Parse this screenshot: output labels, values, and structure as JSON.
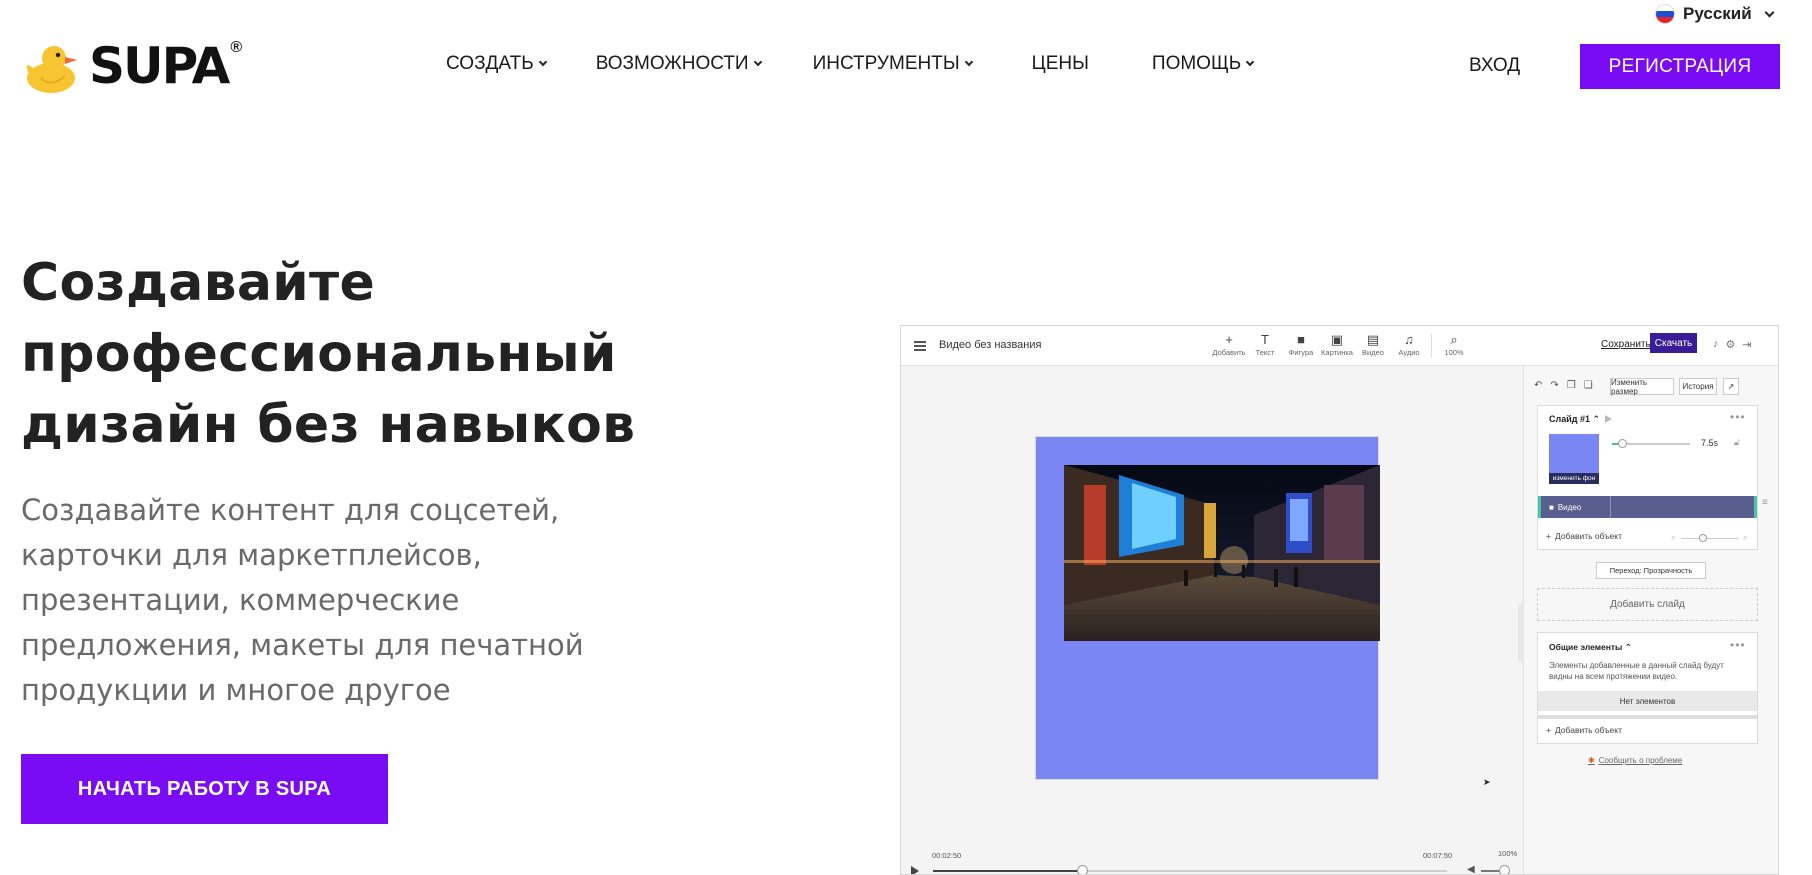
{
  "header": {
    "language": "Русский",
    "logo_text": "SUPA",
    "logo_reg": "®",
    "nav": [
      {
        "label": "СОЗДАТЬ",
        "dropdown": true
      },
      {
        "label": "ВОЗМОЖНОСТИ",
        "dropdown": true
      },
      {
        "label": "ИНСТРУМЕНТЫ",
        "dropdown": true
      },
      {
        "label": "ЦЕНЫ",
        "dropdown": false
      },
      {
        "label": "ПОМОЩЬ",
        "dropdown": true
      }
    ],
    "login": "ВХОД",
    "signup": "РЕГИСТРАЦИЯ"
  },
  "hero": {
    "title_lines": [
      "Создавайте",
      "профессиональный",
      "дизайн без навыков"
    ],
    "subtitle_lines": [
      "Создавайте контент для соцсетей,",
      "карточки для маркетплейсов,",
      "презентации, коммерческие",
      "предложения, макеты для печатной",
      "продукции и многое другое"
    ],
    "cta": "НАЧАТЬ РАБОТУ В SUPA"
  },
  "editor": {
    "doc_title": "Видео без названия",
    "tools": [
      {
        "glyph": "+",
        "label": "Добавить",
        "icon": "plus-icon"
      },
      {
        "glyph": "T",
        "label": "Текст",
        "icon": "text-icon"
      },
      {
        "glyph": "■",
        "label": "Фигура",
        "icon": "shape-icon"
      },
      {
        "glyph": "▣",
        "label": "Картинка",
        "icon": "image-icon"
      },
      {
        "glyph": "▤",
        "label": "Видео",
        "icon": "video-icon"
      },
      {
        "glyph": "♫",
        "label": "Аудио",
        "icon": "audio-icon"
      },
      {
        "glyph": "⌕",
        "label": "100%",
        "icon": "zoom-icon"
      }
    ],
    "save": "Сохранить",
    "download": "Скачать",
    "panel": {
      "resize": "Изменить размер",
      "history": "История",
      "slide_title": "Слайд #1",
      "change_bg": "изменить фон",
      "duration": "7.5s",
      "duration_progress": 0.1,
      "video_layer": "Видео",
      "add_object": "Добавить объект",
      "transition": "Переход: Прозрачность",
      "add_slide": "Добавить слайд",
      "common_title": "Общие элементы",
      "common_desc": "Элементы добавленные в данный слайд будут видны на всем протяжении видео.",
      "no_elements": "Нет элементов",
      "add_object_2": "Добавить объект",
      "report": "Сообщить о проблеме"
    },
    "timeline": {
      "current": "00:02:50",
      "total": "00:07:50",
      "zoom": "100%",
      "progress": 0.29,
      "volume": 0.75
    }
  }
}
